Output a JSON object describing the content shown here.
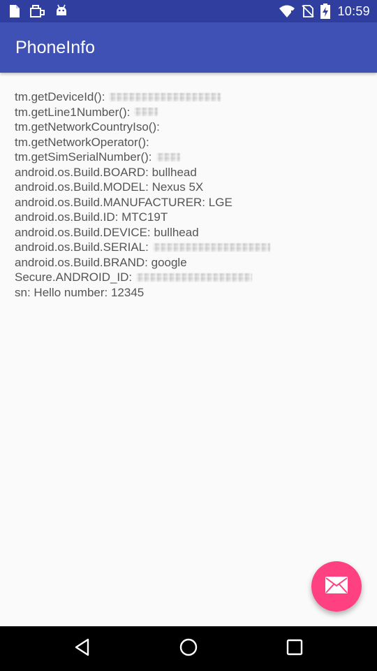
{
  "status_bar": {
    "time": "10:59",
    "left_icons": [
      "document-icon",
      "mail-bag-icon",
      "android-icon"
    ],
    "right_icons": [
      "wifi-icon",
      "no-sim-icon",
      "battery-charging-icon"
    ],
    "color": "#303f9f"
  },
  "app_bar": {
    "title": "PhoneInfo",
    "color": "#3f51b5"
  },
  "info_lines": [
    {
      "label": "tm.getDeviceId():",
      "value": "",
      "redacted": true
    },
    {
      "label": "tm.getLine1Number():",
      "value": "",
      "redacted": true
    },
    {
      "label": "tm.getNetworkCountryIso():",
      "value": "",
      "redacted": false
    },
    {
      "label": "tm.getNetworkOperator():",
      "value": "",
      "redacted": false
    },
    {
      "label": "tm.getSimSerialNumber():",
      "value": "",
      "redacted": true
    },
    {
      "label": "android.os.Build.BOARD:",
      "value": "bullhead",
      "redacted": false
    },
    {
      "label": "android.os.Build.MODEL:",
      "value": "Nexus 5X",
      "redacted": false
    },
    {
      "label": "android.os.Build.MANUFACTURER:",
      "value": "LGE",
      "redacted": false
    },
    {
      "label": "android.os.Build.ID:",
      "value": "MTC19T",
      "redacted": false
    },
    {
      "label": "android.os.Build.DEVICE:",
      "value": "bullhead",
      "redacted": false
    },
    {
      "label": "android.os.Build.SERIAL:",
      "value": "",
      "redacted": true
    },
    {
      "label": "android.os.Build.BRAND:",
      "value": "google",
      "redacted": false
    },
    {
      "label": "Secure.ANDROID_ID:",
      "value": "",
      "redacted": true
    },
    {
      "label": "sn:",
      "value": "Hello number: 12345",
      "redacted": false
    }
  ],
  "fab": {
    "icon": "mail-icon",
    "color": "#ff4081"
  },
  "nav_bar": {
    "buttons": [
      "back-icon",
      "home-icon",
      "recents-icon"
    ]
  }
}
